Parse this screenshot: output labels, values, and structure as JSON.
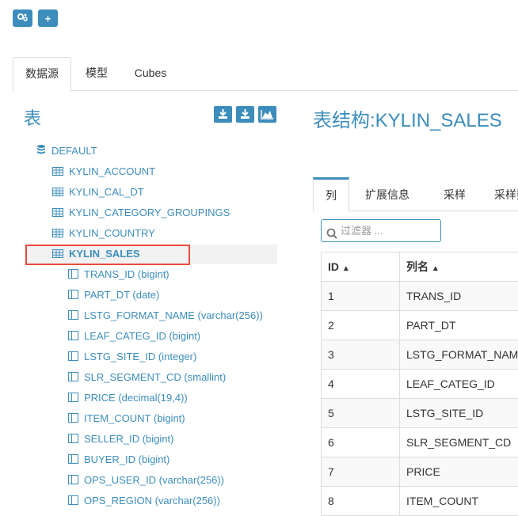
{
  "toolbar": {
    "add_label": "+"
  },
  "tabs": [
    {
      "label": "数据源"
    },
    {
      "label": "模型"
    },
    {
      "label": "Cubes"
    }
  ],
  "left": {
    "title": "表",
    "tree": {
      "database": "DEFAULT",
      "tables": [
        "KYLIN_ACCOUNT",
        "KYLIN_CAL_DT",
        "KYLIN_CATEGORY_GROUPINGS",
        "KYLIN_COUNTRY",
        "KYLIN_SALES"
      ],
      "columns": [
        "TRANS_ID (bigint)",
        "PART_DT (date)",
        "LSTG_FORMAT_NAME (varchar(256))",
        "LEAF_CATEG_ID (bigint)",
        "LSTG_SITE_ID (integer)",
        "SLR_SEGMENT_CD (smallint)",
        "PRICE (decimal(19,4))",
        "ITEM_COUNT (bigint)",
        "SELLER_ID (bigint)",
        "BUYER_ID (bigint)",
        "OPS_USER_ID (varchar(256))",
        "OPS_REGION (varchar(256))"
      ]
    }
  },
  "right": {
    "title": "表结构:KYLIN_SALES",
    "tabs": [
      {
        "label": "列"
      },
      {
        "label": "扩展信息"
      },
      {
        "label": "采样"
      },
      {
        "label": "采样数"
      }
    ],
    "filter_placeholder": "过滤器 ...",
    "table": {
      "headers": [
        "ID",
        "列名"
      ],
      "rows": [
        [
          "1",
          "TRANS_ID"
        ],
        [
          "2",
          "PART_DT"
        ],
        [
          "3",
          "LSTG_FORMAT_NAME"
        ],
        [
          "4",
          "LEAF_CATEG_ID"
        ],
        [
          "5",
          "LSTG_SITE_ID"
        ],
        [
          "6",
          "SLR_SEGMENT_CD"
        ],
        [
          "7",
          "PRICE"
        ],
        [
          "8",
          "ITEM_COUNT"
        ]
      ]
    }
  },
  "colors": {
    "accent": "#3c8dbc",
    "highlight": "#e74c3c"
  }
}
